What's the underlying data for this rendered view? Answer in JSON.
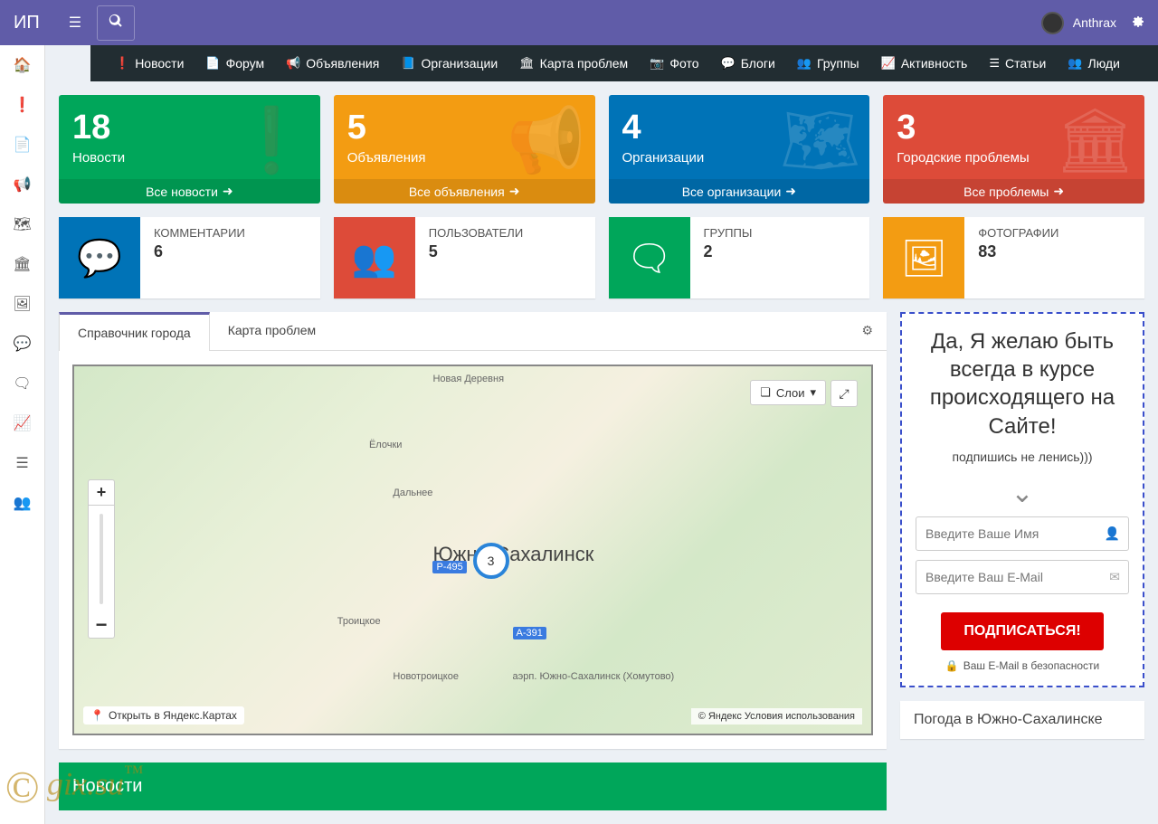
{
  "header": {
    "logo": "ИП",
    "username": "Anthrax"
  },
  "nav": [
    {
      "icon": "info",
      "label": "Новости"
    },
    {
      "icon": "file",
      "label": "Форум"
    },
    {
      "icon": "bullhorn",
      "label": "Объявления"
    },
    {
      "icon": "book",
      "label": "Организации"
    },
    {
      "icon": "building",
      "label": "Карта проблем"
    },
    {
      "icon": "camera",
      "label": "Фото"
    },
    {
      "icon": "comment",
      "label": "Блоги"
    },
    {
      "icon": "users",
      "label": "Группы"
    },
    {
      "icon": "chart",
      "label": "Активность"
    },
    {
      "icon": "bars",
      "label": "Статьи"
    },
    {
      "icon": "people",
      "label": "Люди"
    }
  ],
  "cards": [
    {
      "count": "18",
      "label": "Новости",
      "footer": "Все новости",
      "color": "green"
    },
    {
      "count": "5",
      "label": "Объявления",
      "footer": "Все объявления",
      "color": "orange"
    },
    {
      "count": "4",
      "label": "Организации",
      "footer": "Все организации",
      "color": "blue"
    },
    {
      "count": "3",
      "label": "Городские проблемы",
      "footer": "Все проблемы",
      "color": "red"
    }
  ],
  "info": [
    {
      "title": "КОММЕНТАРИИ",
      "num": "6",
      "color": "ib-blue"
    },
    {
      "title": "ПОЛЬЗОВАТЕЛИ",
      "num": "5",
      "color": "ib-red"
    },
    {
      "title": "ГРУППЫ",
      "num": "2",
      "color": "ib-green"
    },
    {
      "title": "ФОТОГРАФИИ",
      "num": "83",
      "color": "ib-orange"
    }
  ],
  "tabs": {
    "tab1": "Справочник города",
    "tab2": "Карта проблем"
  },
  "map": {
    "layers": "Слои",
    "open": "Открыть в Яндекс.Картах",
    "copyright_prefix": "© Яндекс ",
    "copyright_link": "Условия использования",
    "city": "Южно-Сахалинск",
    "marker_count": "3",
    "labels": {
      "l1": "Новая Деревня",
      "l2": "Ёлочки",
      "l3": "Дальнее",
      "l4": "Троицкое",
      "l5": "Новотроицкое",
      "l6": "аэрп. Южно-Сахалинск (Хомутово)",
      "r1": "Р-495",
      "r2": "А-391"
    }
  },
  "subscribe": {
    "title": "Да, Я желаю быть всегда в курсе происходящего на Сайте!",
    "sub": "подпишись не ленись)))",
    "name_ph": "Введите Ваше Имя",
    "email_ph": "Введите Ваш E-Mail",
    "button": "ПОДПИСАТЬСЯ!",
    "safe": "Ваш E-Mail в безопасности"
  },
  "news_title": "Новости",
  "weather_title": "Погода в Южно-Сахалинске",
  "watermark": "gix.su"
}
